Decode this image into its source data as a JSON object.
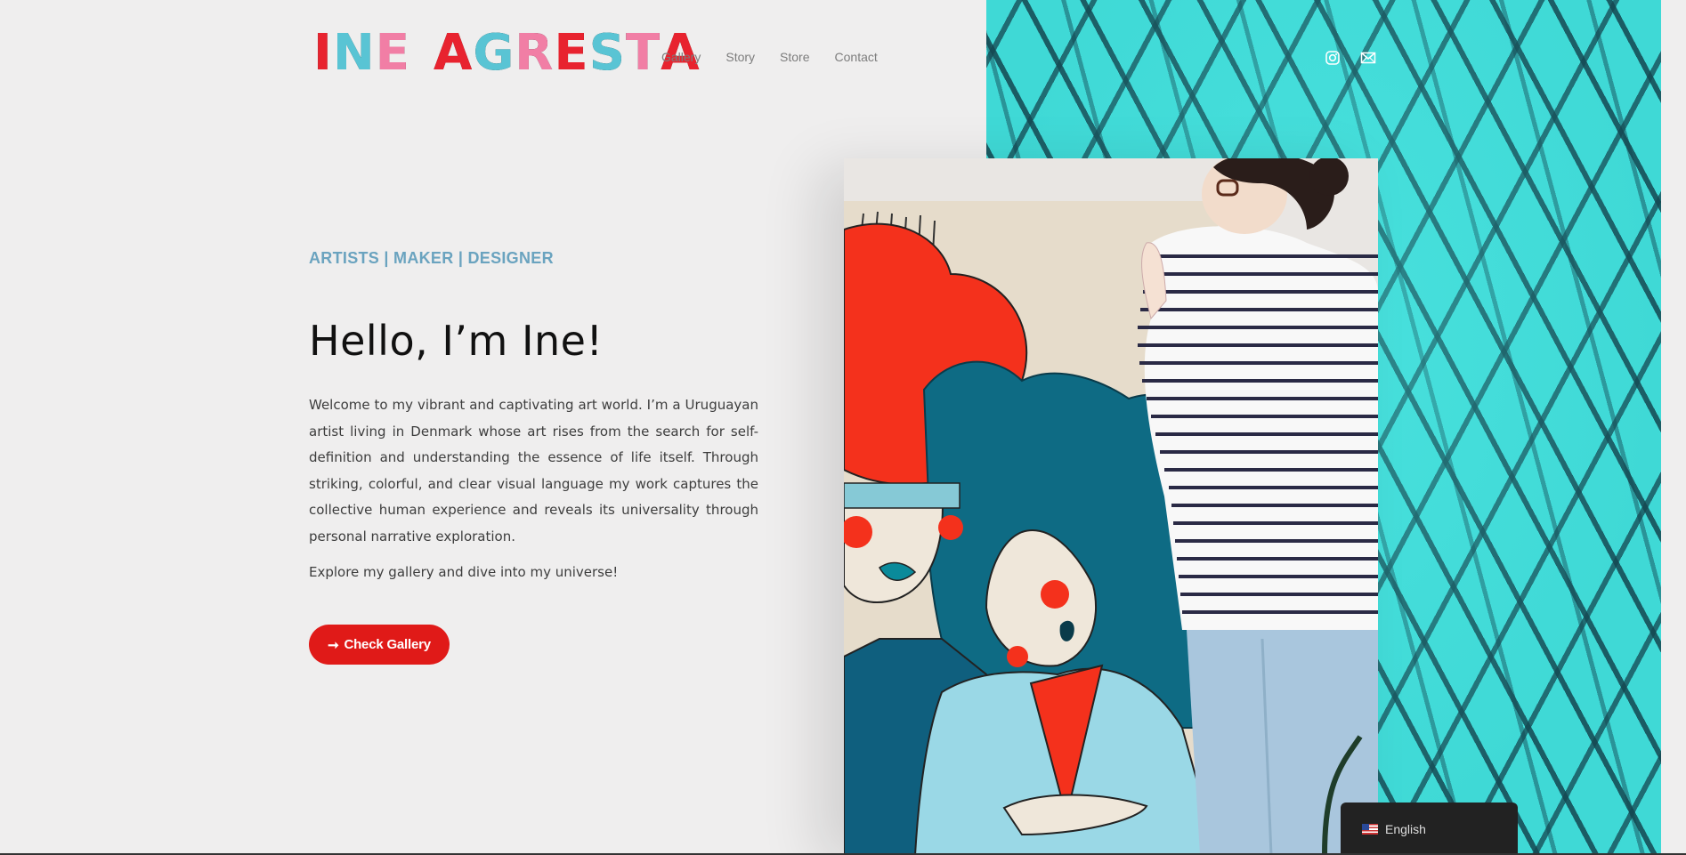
{
  "logo": {
    "letters": [
      {
        "ch": "I",
        "color": "#e8232f"
      },
      {
        "ch": "N",
        "color": "#59c4d4"
      },
      {
        "ch": "E",
        "color": "#f17ea5"
      },
      {
        "ch": " ",
        "color": ""
      },
      {
        "ch": "A",
        "color": "#e8232f"
      },
      {
        "ch": "G",
        "color": "#59c4d4"
      },
      {
        "ch": "R",
        "color": "#f17ea5"
      },
      {
        "ch": "E",
        "color": "#e8232f"
      },
      {
        "ch": "S",
        "color": "#59c4d4"
      },
      {
        "ch": "T",
        "color": "#f17ea5"
      },
      {
        "ch": "A",
        "color": "#e8232f"
      }
    ]
  },
  "nav": {
    "items": [
      "Gallery",
      "Story",
      "Store",
      "Contact"
    ]
  },
  "social": {
    "icons": [
      "instagram-icon",
      "mail-icon"
    ]
  },
  "hero": {
    "tagline": "ARTISTS | MAKER | DESIGNER",
    "title": "Hello, I’m Ine!",
    "intro": "Welcome to my vibrant and captivating art world. I’m a Uruguayan artist living in Denmark whose art rises from the search for self-definition and understanding the essence of life itself. Through striking, colorful, and clear visual language my work captures the collective human experience and reveals its universality through personal narrative exploration.",
    "explore": "Explore my gallery and dive into my universe!",
    "cta_label": "Check Gallery",
    "cta_arrow": "➞"
  },
  "language": {
    "label": "English",
    "flag": "us-flag-icon"
  },
  "colors": {
    "accent": "#e01a18",
    "tagline": "#6aa3bf",
    "panel": "#3fd9d6"
  }
}
